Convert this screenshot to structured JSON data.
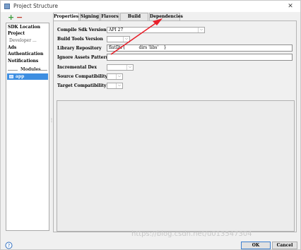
{
  "window": {
    "title": "Project Structure",
    "close_glyph": "✕"
  },
  "toolbar": {
    "add_glyph": "+",
    "remove_glyph": "−"
  },
  "sidebar": {
    "items": [
      {
        "label": "SDK Location"
      },
      {
        "label": "Project"
      },
      {
        "label": "Developer ..."
      },
      {
        "label": "Ads"
      },
      {
        "label": "Authentication"
      },
      {
        "label": "Notifications"
      }
    ],
    "section_label": "Modules",
    "modules": [
      {
        "label": "app",
        "selected": true
      }
    ]
  },
  "tabs": [
    {
      "label": "Properties",
      "active": true
    },
    {
      "label": "Signing",
      "active": false
    },
    {
      "label": "Flavors",
      "active": false
    },
    {
      "label": "Build Types",
      "active": false
    },
    {
      "label": "Dependencies",
      "active": false
    }
  ],
  "properties": {
    "compile_sdk": {
      "label": "Compile Sdk Version",
      "value": "API 27"
    },
    "build_tools": {
      "label": "Build Tools Version",
      "value": ""
    },
    "library_repo": {
      "label": "Library Repository",
      "value": "flatDir{          dirs 'libs'    }"
    },
    "ignore_assets": {
      "label": "Ignore Assets Pattern",
      "value": ""
    },
    "incremental_dex": {
      "label": "Incremental Dex",
      "value": ""
    },
    "source_compat": {
      "label": "Source Compatibility",
      "value": ""
    },
    "target_compat": {
      "label": "Target Compatibility",
      "value": ""
    }
  },
  "buttons": {
    "ok": "OK",
    "cancel": "Cancel"
  },
  "watermark": "https://blog.csdn.net/u013547304",
  "colors": {
    "selection": "#3d8ee1",
    "annotation_arrow": "#e8202a"
  }
}
